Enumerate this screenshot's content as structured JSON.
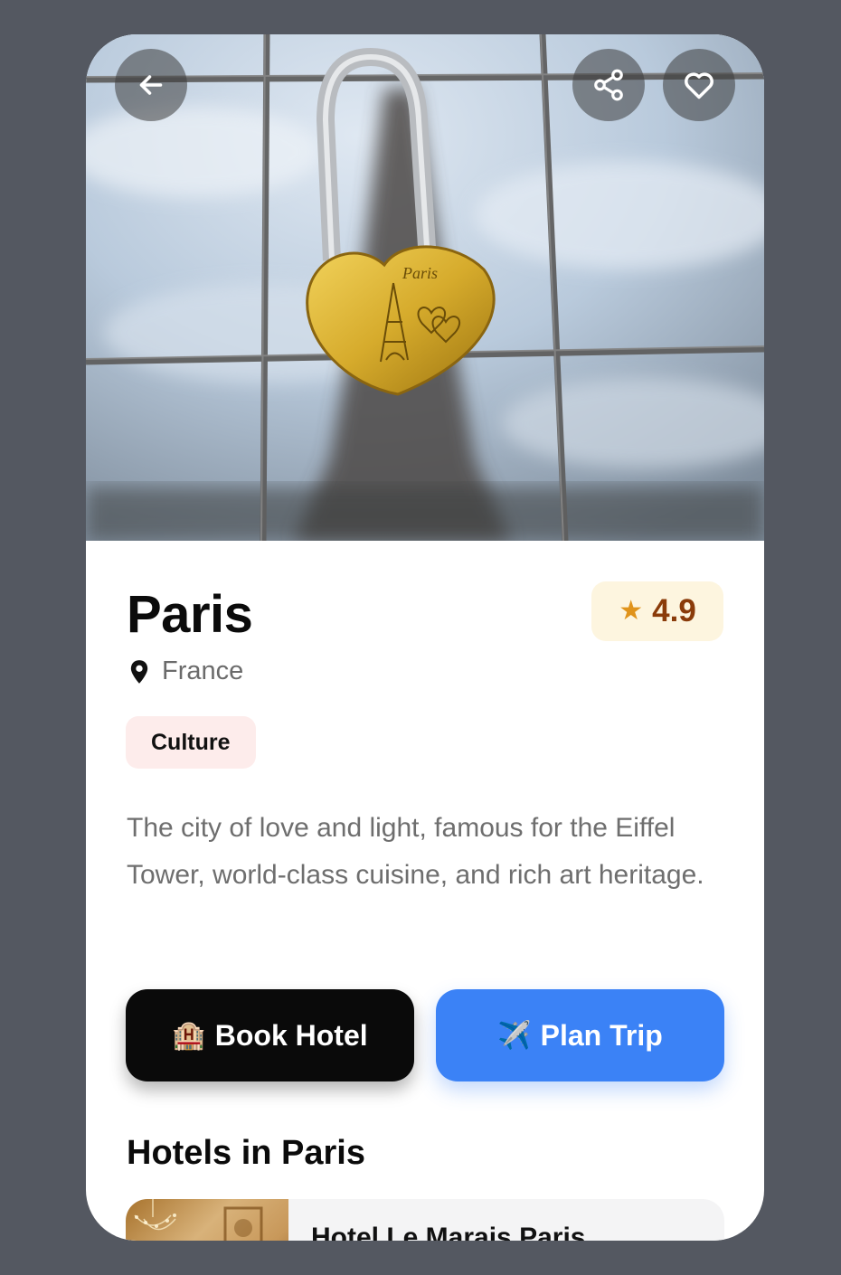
{
  "destination": {
    "name": "Paris",
    "country": "France",
    "rating": "4.9",
    "category": "Culture",
    "description": "The city of love and light, famous for the Eiffel Tower, world-class cuisine, and rich art heritage."
  },
  "actions": {
    "book_icon": "🏨",
    "book_label": "Book Hotel",
    "plan_icon": "✈️",
    "plan_label": "Plan Trip"
  },
  "hotels_section": {
    "title": "Hotels in Paris",
    "items": [
      {
        "name": "Hotel Le Marais Paris"
      }
    ]
  },
  "icons": {
    "back": "arrow-left-icon",
    "share": "share-icon",
    "favorite": "heart-icon",
    "location": "map-pin-icon",
    "rating": "star-icon"
  },
  "colors": {
    "rating_bg": "#fdf5df",
    "rating_text": "#8a3b0a",
    "star": "#e0931b",
    "tag_bg": "#fdeceb",
    "primary_blue": "#3b82f6",
    "dark_button": "#0a0a0a"
  }
}
